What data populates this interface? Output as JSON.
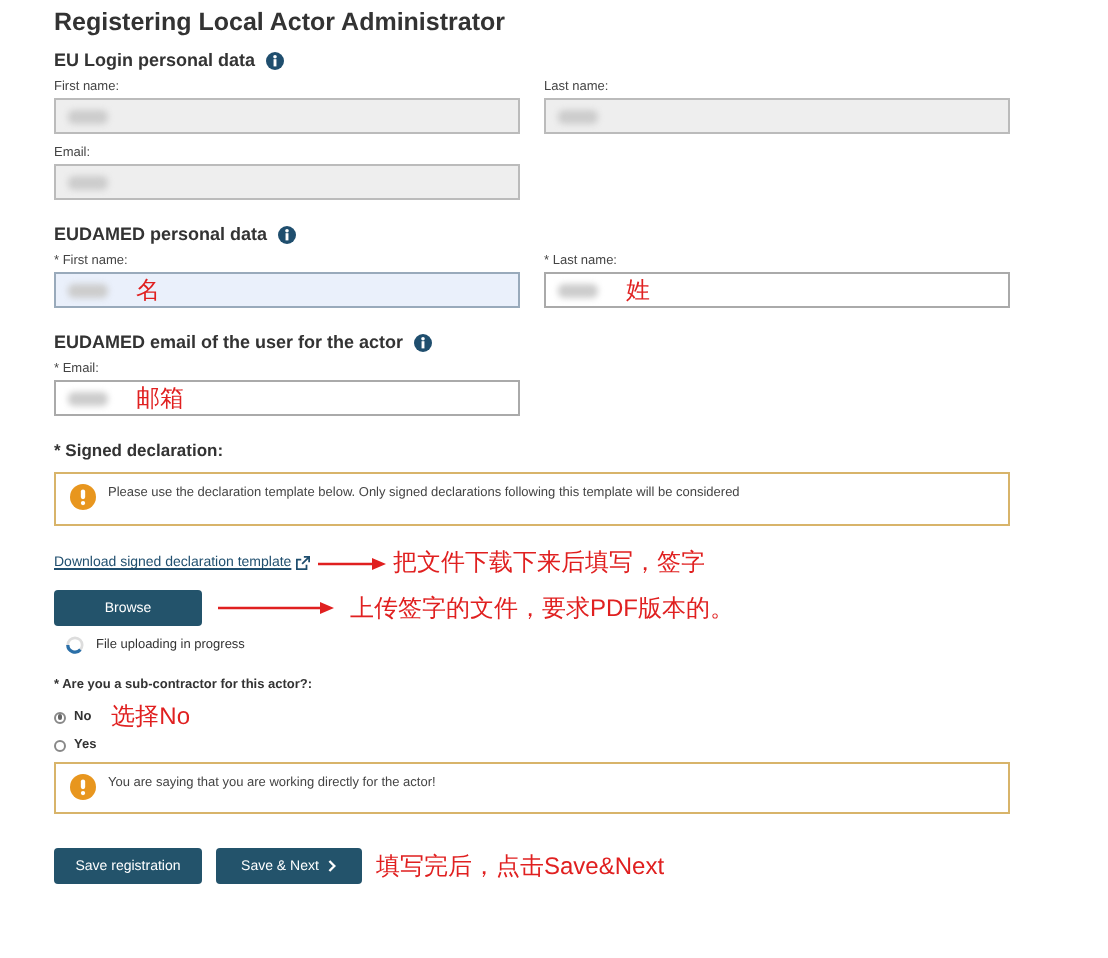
{
  "page_title": "Registering Local Actor Administrator",
  "sections": [
    {
      "heading": "EU Login personal data",
      "info": true,
      "rows": [
        [
          {
            "label": "First name:",
            "disabled": true,
            "focused": false,
            "redacted": true
          },
          {
            "label": "Last name:",
            "disabled": true,
            "focused": false,
            "redacted": true
          }
        ],
        [
          {
            "label": "Email:",
            "disabled": true,
            "focused": false,
            "redacted": true
          }
        ]
      ]
    },
    {
      "heading": "EUDAMED personal data",
      "info": true,
      "rows": [
        [
          {
            "label": "* First name:",
            "disabled": false,
            "focused": true,
            "redacted": true,
            "annotation": "名"
          },
          {
            "label": "* Last name:",
            "disabled": false,
            "focused": false,
            "redacted": true,
            "annotation": "姓"
          }
        ]
      ]
    },
    {
      "heading": "EUDAMED email of the user for the actor",
      "info": true,
      "rows": [
        [
          {
            "label": "* Email:",
            "disabled": false,
            "focused": false,
            "redacted": true,
            "annotation": "邮箱"
          }
        ]
      ]
    }
  ],
  "declaration": {
    "label": "* Signed declaration:",
    "notice": "Please use the declaration template below. Only signed declarations following this template will be considered",
    "link": "Download signed declaration template",
    "link_annotation": "把文件下载下来后填写，签字",
    "button": "Browse",
    "button_annotation": "上传签字的文件，要求PDF版本的。",
    "status": "File uploading in progress"
  },
  "question": {
    "label": "* Are you a sub-contractor for this actor?:",
    "options": [
      {
        "label": "No",
        "selected": true,
        "annotation": "选择No"
      },
      {
        "label": "Yes",
        "selected": false
      }
    ],
    "notice": "You are saying that you are working directly for the actor!"
  },
  "actions": [
    {
      "label": "Save registration",
      "chevron": false
    },
    {
      "label": "Save & Next",
      "chevron": true
    }
  ],
  "actions_annotation": "填写完后，点击Save&Next"
}
